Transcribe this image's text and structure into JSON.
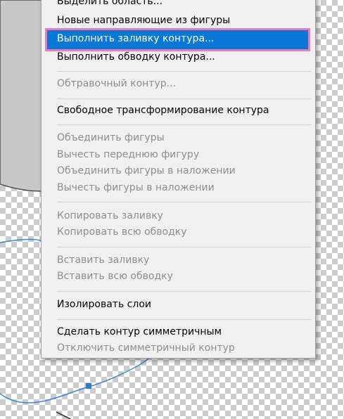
{
  "menu": {
    "items": [
      {
        "label": "Выделить область...",
        "enabled": true
      },
      {
        "label": "Новые направляющие из фигуры",
        "enabled": true
      },
      {
        "label": "Выполнить заливку контура...",
        "enabled": true,
        "highlighted": true
      },
      {
        "label": "Выполнить обводку контура...",
        "enabled": true
      },
      {
        "label": "Обтравочный контур...",
        "enabled": false
      },
      {
        "label": "Свободное трансформирование контура",
        "enabled": true
      },
      {
        "label": "Объединить фигуры",
        "enabled": false
      },
      {
        "label": "Вычесть переднюю фигуру",
        "enabled": false
      },
      {
        "label": "Объединить фигуры в наложении",
        "enabled": false
      },
      {
        "label": "Вычесть фигуры в наложении",
        "enabled": false
      },
      {
        "label": "Копировать заливку",
        "enabled": false
      },
      {
        "label": "Копировать всю обводку",
        "enabled": false
      },
      {
        "label": "Вставить заливку",
        "enabled": false
      },
      {
        "label": "Вставить всю обводку",
        "enabled": false
      },
      {
        "label": "Изолировать слои",
        "enabled": true
      },
      {
        "label": "Сделать контур симметричным",
        "enabled": true
      },
      {
        "label": "Отключить симметричный контур",
        "enabled": false
      }
    ]
  },
  "colors": {
    "highlight": "#0a78d7",
    "highlight_outline": "#f07ab4",
    "path_stroke": "#3b84d9",
    "shape_fill": "#c8c8c8"
  }
}
